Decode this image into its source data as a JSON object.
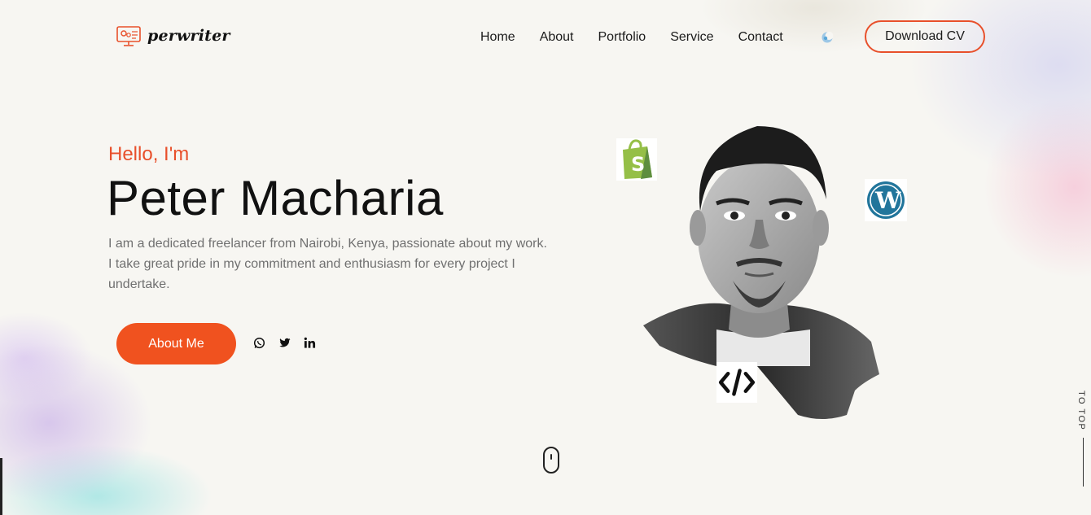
{
  "brand": {
    "name": "perwriter",
    "accent": "#e8502b"
  },
  "nav": {
    "items": [
      "Home",
      "About",
      "Portfolio",
      "Service",
      "Contact"
    ],
    "theme_icon": "theme-toggle-icon",
    "download_cv": "Download CV"
  },
  "hero": {
    "greeting": "Hello, I'm",
    "name": "Peter Macharia",
    "bio": "I am a dedicated freelancer from Nairobi, Kenya, passionate about my work. I take great pride in my commitment and enthusiasm for every project I undertake.",
    "about_button": "About Me",
    "socials": [
      "whatsapp-icon",
      "twitter-icon",
      "linkedin-icon"
    ]
  },
  "badges": [
    "shopify-icon",
    "wordpress-icon",
    "code-icon"
  ],
  "scroll_indicator": "mouse-icon",
  "to_top": "TO TOP"
}
